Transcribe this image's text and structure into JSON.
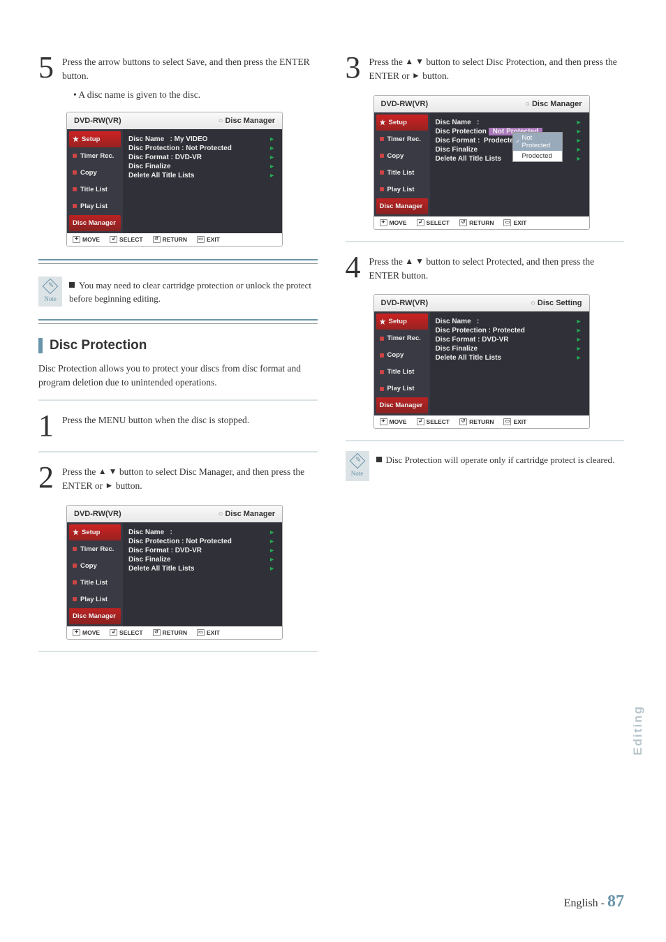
{
  "left": {
    "step5": {
      "num": "5",
      "text": "Press the arrow buttons to select Save, and then press the ENTER button.",
      "bullet": "• A disc name is given to the disc."
    },
    "osd5": {
      "model": "DVD-RW(VR)",
      "title": "Disc Manager",
      "sidebar": [
        "Setup",
        "Timer Rec.",
        "Copy",
        "Title List",
        "Play List",
        "Disc Manager"
      ],
      "rows": [
        {
          "label": "Disc Name",
          "sep": ":",
          "value": "My VIDEO"
        },
        {
          "label": "Disc Protection :",
          "value": "Not Protected"
        },
        {
          "label": "Disc Format  :",
          "value": "DVD-VR"
        },
        {
          "label": "Disc Finalize",
          "value": ""
        },
        {
          "label": "Delete All Title Lists",
          "value": ""
        }
      ],
      "foot": [
        "MOVE",
        "SELECT",
        "RETURN",
        "EXIT"
      ]
    },
    "note1": "You may need to clear cartridge protection or unlock the protect before beginning editing.",
    "section": {
      "title": "Disc Protection",
      "desc": "Disc Protection allows you to protect your discs from disc format and program deletion due to unintended operations."
    },
    "step1": {
      "num": "1",
      "text": "Press the MENU button when the disc is stopped."
    },
    "step2": {
      "num": "2",
      "text_a": "Press the ",
      "text_b": " button to select Disc Manager, and then press the ENTER or ",
      "text_c": " button."
    },
    "osd2": {
      "model": "DVD-RW(VR)",
      "title": "Disc Manager",
      "sidebar": [
        "Setup",
        "Timer Rec.",
        "Copy",
        "Title List",
        "Play List",
        "Disc Manager"
      ],
      "rows": [
        {
          "label": "Disc Name",
          "sep": ":",
          "value": ""
        },
        {
          "label": "Disc Protection :",
          "value": "Not Protected"
        },
        {
          "label": "Disc Format  :",
          "value": "DVD-VR"
        },
        {
          "label": "Disc Finalize",
          "value": ""
        },
        {
          "label": "Delete All Title Lists",
          "value": ""
        }
      ],
      "foot": [
        "MOVE",
        "SELECT",
        "RETURN",
        "EXIT"
      ]
    }
  },
  "right": {
    "step3": {
      "num": "3",
      "text_a": "Press the ",
      "text_b": " button to select Disc Protection, and then press the ENTER or ",
      "text_c": " button."
    },
    "osd3": {
      "model": "DVD-RW(VR)",
      "title": "Disc Manager",
      "sidebar": [
        "Setup",
        "Timer Rec.",
        "Copy",
        "Title List",
        "Play List",
        "Disc Manager"
      ],
      "rows": [
        {
          "label": "Disc Name",
          "sep": ":",
          "value": ""
        },
        {
          "label": "Disc Protection :",
          "value": "Not Protected",
          "popup": true
        },
        {
          "label": "Disc Format  :",
          "value": "Prodected"
        },
        {
          "label": "Disc Finalize",
          "value": ""
        },
        {
          "label": "Delete All Title Lists",
          "value": ""
        }
      ],
      "popup": {
        "items": [
          "Not Protected",
          "Prodected"
        ],
        "selected": 0
      },
      "foot": [
        "MOVE",
        "SELECT",
        "RETURN",
        "EXIT"
      ]
    },
    "step4": {
      "num": "4",
      "text_a": "Press the ",
      "text_b": " button to select Protected, and then press the ENTER button."
    },
    "osd4": {
      "model": "DVD-RW(VR)",
      "title": "Disc Setting",
      "sidebar": [
        "Setup",
        "Timer Rec.",
        "Copy",
        "Title List",
        "Play List",
        "Disc Manager"
      ],
      "rows": [
        {
          "label": "Disc Name",
          "sep": ":",
          "value": ""
        },
        {
          "label": "Disc Protection :",
          "value": "Protected"
        },
        {
          "label": "Disc Format  :",
          "value": "DVD-VR"
        },
        {
          "label": "Disc Finalize",
          "value": ""
        },
        {
          "label": "Delete All Title Lists",
          "value": ""
        }
      ],
      "foot": [
        "MOVE",
        "SELECT",
        "RETURN",
        "EXIT"
      ]
    },
    "note2": "Disc Protection will operate only if cartridge protect is cleared."
  },
  "glyphs": {
    "updown": "▲ ▼",
    "right": "►",
    "note_label": "Note"
  },
  "footer": {
    "lang": "English -",
    "page": "87"
  },
  "sidetab": "Editing"
}
